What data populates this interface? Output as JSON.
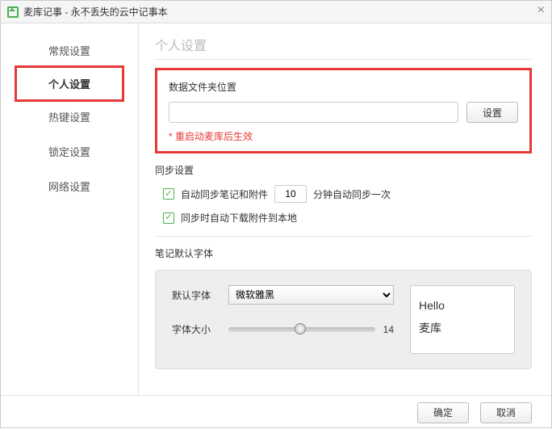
{
  "window": {
    "title": "麦库记事 - 永不丢失的云中记事本"
  },
  "sidebar": {
    "items": [
      {
        "label": "常规设置"
      },
      {
        "label": "个人设置"
      },
      {
        "label": "热键设置"
      },
      {
        "label": "锁定设置"
      },
      {
        "label": "网络设置"
      }
    ],
    "selected_index": 1
  },
  "page": {
    "heading": "个人设置",
    "data_folder": {
      "title": "数据文件夹位置",
      "path": "",
      "set_button": "设置",
      "note": "* 重启动麦库后生效"
    },
    "sync": {
      "title": "同步设置",
      "auto_sync": {
        "checked": true,
        "label": "自动同步笔记和附件",
        "interval": "10",
        "suffix": "分钟自动同步一次"
      },
      "download_local": {
        "checked": true,
        "label": "同步时自动下载附件到本地"
      }
    },
    "font": {
      "title": "笔记默认字体",
      "default_label": "默认字体",
      "default_value": "微软雅黑",
      "size_label": "字体大小",
      "size_value": "14",
      "preview_line1": "Hello",
      "preview_line2": "麦库"
    }
  },
  "footer": {
    "ok": "确定",
    "cancel": "取消"
  }
}
